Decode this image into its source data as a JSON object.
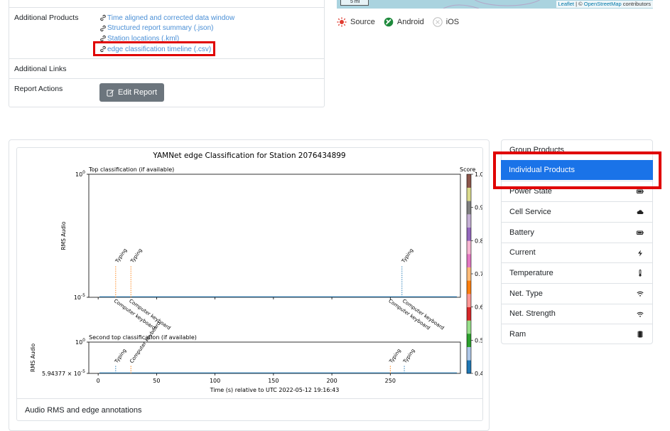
{
  "report": {
    "rows": {
      "additional_products": "Additional Products",
      "additional_links": "Additional Links",
      "report_actions": "Report Actions"
    },
    "products": [
      "Time aligned and corrected data window",
      "Structured report summary (.json)",
      "Station locations (.kml)",
      "edge classification timeline (.csv)"
    ],
    "edit_button": "Edit Report"
  },
  "map": {
    "scale_label": "5 mi",
    "attribution_leaflet": "Leaflet",
    "attribution_sep": " | © ",
    "attribution_osm": "OpenStreetMap",
    "attribution_tail": " contributors"
  },
  "platforms": [
    "Source",
    "Android",
    "iOS"
  ],
  "plot": {
    "caption": "Audio RMS and edge annotations"
  },
  "chart_data": {
    "type": "scatter",
    "title": "YAMNet edge Classification for Station 2076434899",
    "xlabel": "Time (s) relative to UTC 2022-05-12 19:16:43",
    "x_ticks": [
      "0",
      "50",
      "100",
      "150",
      "200",
      "250"
    ],
    "xlim": [
      -8,
      310
    ],
    "colorbar": {
      "label": "Score",
      "range": [
        0.4,
        1.0
      ],
      "ticks": [
        "1.0",
        "0.9",
        "0.8",
        "0.7",
        "0.6",
        "0.5",
        "0.4"
      ],
      "colors": [
        "#1f77b4",
        "#aec7e8",
        "#2ca02c",
        "#98df8a",
        "#d62728",
        "#ff9896",
        "#ff7f0e",
        "#ffbb78",
        "#e377c2",
        "#f7b6d2",
        "#9467bd",
        "#c5b0d5",
        "#7f7f7f",
        "#dbdb8d",
        "#8c564b"
      ]
    },
    "panels": [
      {
        "subtitle": "Top classification (if available)",
        "ylabel": "RMS Audio",
        "y_ticks": [
          "10^0",
          "10^-5"
        ],
        "annotations": [
          {
            "x": 15,
            "label": "Typing",
            "color": "#ff7f0e",
            "side": "top"
          },
          {
            "x": 28,
            "label": "Typing",
            "color": "#ff7f0e",
            "side": "top"
          },
          {
            "x": 15,
            "label": "Computer keyboard",
            "color": "#ff7f0e",
            "side": "bottom"
          },
          {
            "x": 28,
            "label": "Computer keyboard",
            "color": "#ff7f0e",
            "side": "bottom"
          },
          {
            "x": 260,
            "label": "Typing",
            "color": "#1f77b4",
            "side": "top"
          },
          {
            "x": 250,
            "label": "Computer keyboard",
            "color": "#1f77b4",
            "side": "bottom"
          },
          {
            "x": 262,
            "label": "Computer keyboard",
            "color": "#1f77b4",
            "side": "bottom"
          }
        ]
      },
      {
        "subtitle": "Second top classification (if available)",
        "ylabel": "RMS Audio",
        "y_ticks": [
          "10^0",
          "5.94377 × 10^-5"
        ],
        "annotations": [
          {
            "x": 15,
            "label": "Typing",
            "color": "#1f77b4"
          },
          {
            "x": 28,
            "label": "Computer keyboard",
            "color": "#ff7f0e"
          },
          {
            "x": 250,
            "label": "Typing",
            "color": "#ff7f0e"
          },
          {
            "x": 262,
            "label": "Typing",
            "color": "#1f77b4"
          }
        ]
      }
    ]
  },
  "side_list": {
    "items": [
      "Group Products",
      "Individual Products",
      "Power State",
      "Cell Service",
      "Battery",
      "Current",
      "Temperature",
      "Net. Type",
      "Net. Strength",
      "Ram"
    ],
    "active_index": 1,
    "active_color": "#1a73e8",
    "icons": [
      "battery-icon",
      "cloud-icon",
      "battery-icon",
      "bolt-icon",
      "thermometer-icon",
      "wifi-icon",
      "wifi-icon",
      "memory-icon"
    ]
  },
  "highlight_color": "#e00000"
}
